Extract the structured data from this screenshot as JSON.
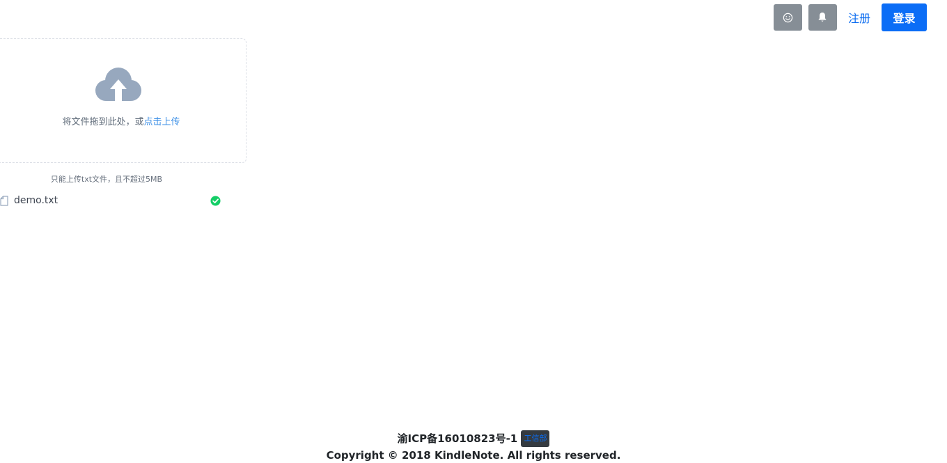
{
  "nav": {
    "emoji_icon": "smiley-icon",
    "bell_icon": "bell-icon",
    "register_label": "注册",
    "login_label": "登录"
  },
  "upload": {
    "icon": "cloud-upload-icon",
    "drop_text": "将文件拖到此处，或",
    "click_text": "点击上传",
    "tip": "只能上传txt文件，且不超过5MB",
    "files": [
      {
        "name": "demo.txt",
        "status": "success"
      }
    ]
  },
  "footer": {
    "icp": "渝ICP备16010823号-1",
    "badge": "工信部",
    "copyright": "Copyright © 2018 KindleNote. All rights reserved."
  },
  "colors": {
    "primary": "#0b6df6",
    "gray_button": "#868e96",
    "success": "#13ce66"
  }
}
